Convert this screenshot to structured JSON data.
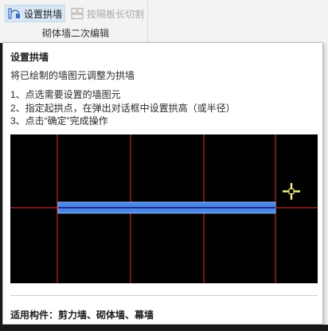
{
  "ribbon": {
    "set_arch_label": "设置拱墙",
    "cut_by_slab_label": "按隔板长切割",
    "group_label": "砌体墙二次编辑"
  },
  "tooltip": {
    "title": "设置拱墙",
    "description": "将已绘制的墙图元调整为拱墙",
    "steps": [
      "1、点选需要设置的墙图元",
      "2、指定起拱点，在弹出对话框中设置拱高（或半径）",
      "3、点击“确定”完成操作"
    ],
    "footer": "适用构件：剪力墙、砌体墙、幕墙"
  },
  "colors": {
    "canvas_background": "#000000",
    "grid_line": "#e03030",
    "wall_fill": "#4a86e8",
    "wall_center_line": "#1a2f8f",
    "cursor": "#f0f080",
    "ribbon_active": "#d8e6f5"
  },
  "icons": {
    "set_arch": "arch-wall-icon",
    "cut_by_slab": "cut-wall-icon",
    "cursor": "crosshair-cursor-icon"
  }
}
